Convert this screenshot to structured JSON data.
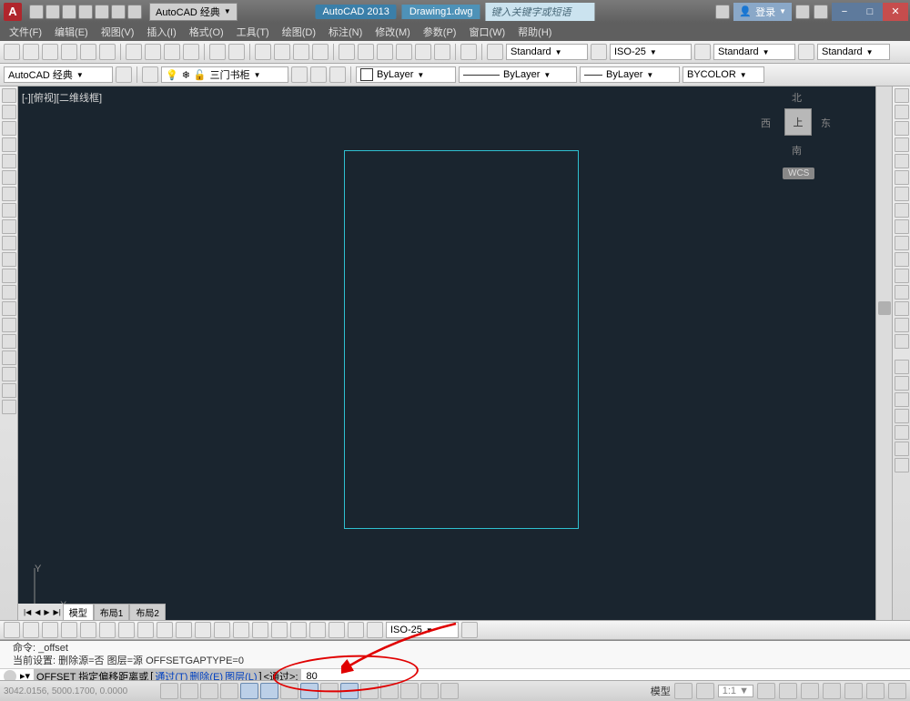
{
  "title": {
    "app": "AutoCAD 2013",
    "file": "Drawing1.dwg",
    "workspace": "AutoCAD 经典",
    "search_placeholder": "键入关键字或短语",
    "login": "登录"
  },
  "menu": {
    "items": [
      "文件(F)",
      "编辑(E)",
      "视图(V)",
      "插入(I)",
      "格式(O)",
      "工具(T)",
      "绘图(D)",
      "标注(N)",
      "修改(M)",
      "参数(P)",
      "窗口(W)",
      "帮助(H)"
    ]
  },
  "toolbar": {
    "style1": "Standard",
    "dimstyle": "ISO-25",
    "style2": "Standard",
    "style3": "Standard",
    "workspace": "AutoCAD 经典",
    "layer_name": "三门书柜",
    "bylayer": "ByLayer",
    "bycolor": "BYCOLOR"
  },
  "dim_toolbar": {
    "style": "ISO-25"
  },
  "viewport": {
    "label": "[-][俯视][二维线框]",
    "nav": {
      "n": "北",
      "s": "南",
      "e": "东",
      "w": "西",
      "top": "上",
      "wcs": "WCS"
    },
    "ucs": {
      "x": "X",
      "y": "Y"
    }
  },
  "tabs": {
    "model": "模型",
    "layout1": "布局1",
    "layout2": "布局2"
  },
  "command": {
    "history1": "命令: _offset",
    "history2": "当前设置: 删除源=否  图层=源  OFFSETGAPTYPE=0",
    "prompt_head": "OFFSET 指定偏移距离或",
    "opt_through": "通过(T)",
    "opt_erase": "删除(E)",
    "opt_layer": "图层(L)",
    "prompt_default": "<通过>:",
    "input_value": "80"
  },
  "status": {
    "coords": "3042.0156, 5000.1700, 0.0000",
    "model": "模型",
    "ratio": "1:1"
  }
}
